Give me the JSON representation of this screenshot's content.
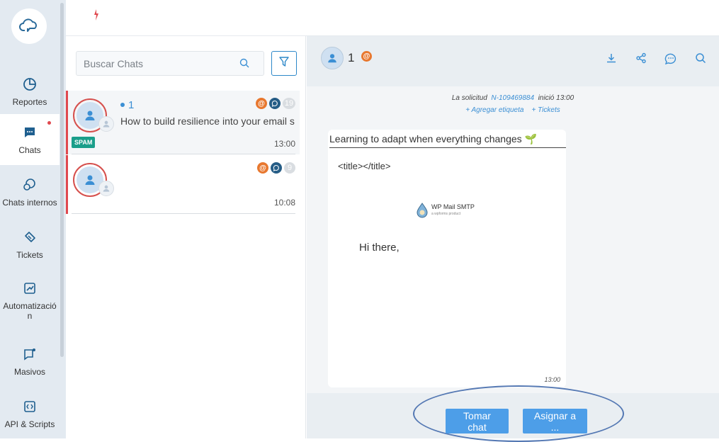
{
  "sidebar": {
    "items": [
      {
        "label": "Reportes",
        "icon": "pie-chart-icon"
      },
      {
        "label": "Chats",
        "icon": "chat-icon"
      },
      {
        "label": "Chats internos",
        "icon": "internal-chats-icon"
      },
      {
        "label": "Tickets",
        "icon": "ticket-icon"
      },
      {
        "label": "Automatización",
        "icon": "automation-icon"
      },
      {
        "label": "Masivos",
        "icon": "broadcast-icon"
      },
      {
        "label": "API & Scripts",
        "icon": "code-icon"
      }
    ],
    "active": "Chats"
  },
  "search": {
    "placeholder": "Buscar Chats"
  },
  "chats": [
    {
      "name": "1",
      "preview": "How to build resilience into your email s",
      "count": "19",
      "time": "13:00",
      "tag": "SPAM"
    },
    {
      "name": "",
      "preview": "",
      "count": "9",
      "time": "10:08",
      "tag": ""
    }
  ],
  "conversation": {
    "contact_name": "1",
    "system": {
      "prefix": "La solicitud",
      "ticket_id": "N-109469884",
      "suffix": "inició 13:00",
      "add_tag": "+ Agregar etiqueta",
      "tickets": "+ Tickets"
    },
    "message": {
      "subject": "Learning to adapt when everything changes 🌱",
      "html_title": "<title></title>",
      "logo_name": "WP Mail SMTP",
      "logo_sub": "a wpforms product",
      "greeting": "Hi there,",
      "time": "13:00"
    },
    "actions": {
      "take": "Tomar chat",
      "assign": "Asignar a ..."
    }
  },
  "colors": {
    "accent": "#3b8fd4",
    "alert": "#e0484e",
    "spam": "#1a9e8a",
    "email": "#e8782f",
    "button": "#4d9ee8"
  }
}
